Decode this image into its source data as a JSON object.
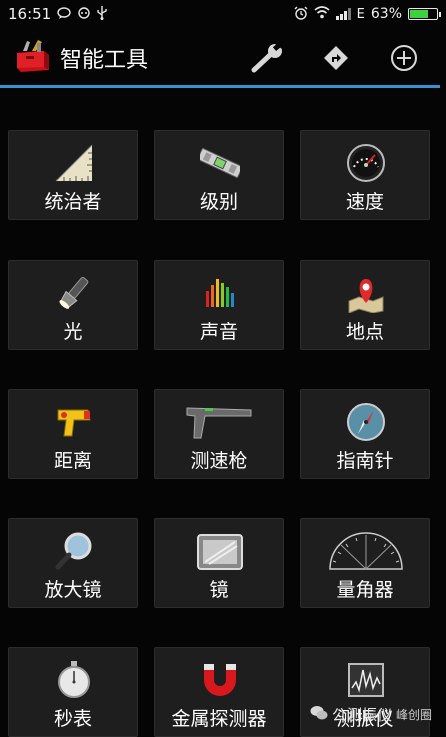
{
  "status_bar": {
    "time": "16:51",
    "network_label": "E",
    "battery_text": "63%",
    "battery_level": 0.63,
    "left_icons": [
      "chat-icon",
      "message-icon",
      "usb-icon"
    ],
    "right_icons": [
      "alarm-icon",
      "wifi-icon",
      "signal-icon",
      "battery-icon"
    ]
  },
  "action_bar": {
    "title": "智能工具",
    "actions": [
      "wrench-icon",
      "directions-icon",
      "add-circle-icon"
    ]
  },
  "tools": [
    {
      "label": "统治者",
      "icon": "ruler-icon"
    },
    {
      "label": "级别",
      "icon": "spirit-level-icon"
    },
    {
      "label": "速度",
      "icon": "speedometer-icon"
    },
    {
      "label": "光",
      "icon": "flashlight-icon"
    },
    {
      "label": "声音",
      "icon": "sound-meter-icon"
    },
    {
      "label": "地点",
      "icon": "location-pin-icon"
    },
    {
      "label": "距离",
      "icon": "distance-gun-icon"
    },
    {
      "label": "测速枪",
      "icon": "speed-gun-icon"
    },
    {
      "label": "指南针",
      "icon": "compass-icon"
    },
    {
      "label": "放大镜",
      "icon": "magnifier-icon"
    },
    {
      "label": "镜",
      "icon": "mirror-icon"
    },
    {
      "label": "量角器",
      "icon": "protractor-icon"
    },
    {
      "label": "秒表",
      "icon": "stopwatch-icon"
    },
    {
      "label": "金属探测器",
      "icon": "magnet-icon"
    },
    {
      "label": "测振仪",
      "icon": "vibrometer-icon"
    }
  ],
  "watermark": {
    "text_main": "公测振仪",
    "text_small": "峰创圈"
  },
  "colors": {
    "accent_divider": "#3a8fd0",
    "tile_background": "#1e1e1e",
    "battery_fill": "#3cd23c"
  }
}
